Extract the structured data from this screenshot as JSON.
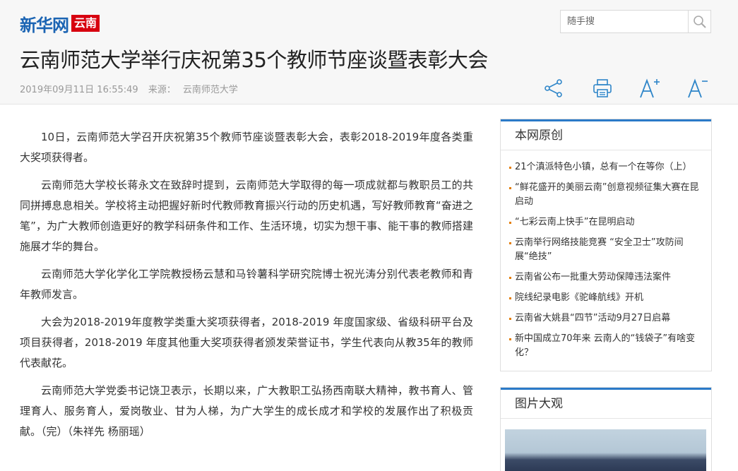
{
  "site": {
    "logo_text": "新华网",
    "channel_badge": "云南"
  },
  "search": {
    "placeholder": "随手搜",
    "icon": "search-icon"
  },
  "article": {
    "title": "云南师范大学举行庆祝第35个教师节座谈暨表彰大会",
    "datetime": "2019年09月11日 16:55:49",
    "source_label": "来源：",
    "source": "云南师范大学",
    "paragraphs": [
      "10日，云南师范大学召开庆祝第35个教师节座谈暨表彰大会，表彰2018-2019年度各类重大奖项获得者。",
      "云南师范大学校长蒋永文在致辞时提到，云南师范大学取得的每一项成就都与教职员工的共同拼搏息息相关。学校将主动把握好新时代教师教育振兴行动的历史机遇，写好教师教育“奋进之笔”，为广大教师创造更好的教学科研条件和工作、生活环境，切实为想干事、能干事的教师搭建施展才华的舞台。",
      "云南师范大学化学化工学院教授杨云慧和马铃薯科学研究院博士祝光涛分别代表老教师和青年教师发言。",
      "大会为2018-2019年度教学类重大奖项获得者，2018-2019 年度国家级、省级科研平台及项目获得者，2018-2019 年度其他重大奖项获得者颁发荣誉证书，学生代表向从教35年的教师代表献花。",
      "云南师范大学党委书记饶卫表示，长期以来，广大教职工弘扬西南联大精神，教书育人、管理育人、服务育人，爱岗敬业、甘为人梯，为广大学生的成长成才和学校的发展作出了积极贡献。（完）（朱祥先 杨丽瑶）"
    ]
  },
  "toolbar": {
    "share_icon": "share-icon",
    "print_icon": "print-icon",
    "font_increase_icon": "font-increase-icon",
    "font_decrease_icon": "font-decrease-icon"
  },
  "sidebar": {
    "original": {
      "title": "本网原创",
      "items": [
        "21个滇派特色小镇，总有一个在等你（上）",
        "“鲜花盛开的美丽云南”创意视频征集大赛在昆启动",
        "“七彩云南上快手”在昆明启动",
        "云南举行网络技能竞赛 “安全卫士”攻防间展“绝技”",
        "云南省公布一批重大劳动保障违法案件",
        "院线纪录电影《驼峰航线》开机",
        "云南省大姚县“四节”活动9月27日启幕",
        "新中国成立70年来 云南人的“钱袋子”有啥变化？"
      ]
    },
    "photos": {
      "title": "图片大观"
    }
  },
  "colors": {
    "brand_blue": "#1b64b3",
    "brand_red": "#d7000f",
    "accent_blue": "#2b7ac8",
    "icon_blue": "#2f86c9",
    "bullet_orange": "#e47d00"
  }
}
